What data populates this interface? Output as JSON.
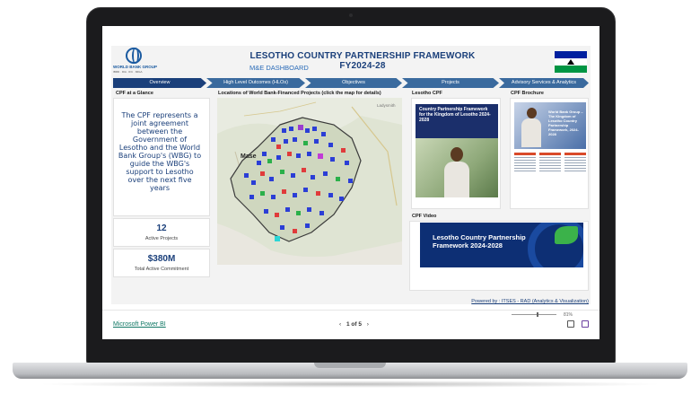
{
  "header": {
    "org_logo_text": "WORLD BANK GROUP",
    "org_logo_sub": "IBRD · IDA · IFC · MIGA",
    "title": "LESOTHO COUNTRY PARTNERSHIP FRAMEWORK FY2024-28",
    "subtitle": "M&E DASHBOARD"
  },
  "nav": [
    {
      "label": "Overview"
    },
    {
      "label": "High Level Outcomes (HLOs)"
    },
    {
      "label": "Objectives"
    },
    {
      "label": "Projects"
    },
    {
      "label": "Advisory Services & Analytics"
    }
  ],
  "glance": {
    "header": "CPF at a Glance",
    "text": "The CPF represents a joint agreement between the Government of Lesotho and the World Bank Group's (WBG) to guide the WBG's support to Lesotho over the next five years",
    "kpis": [
      {
        "value": "12",
        "label": "Active Projects"
      },
      {
        "value": "$380M",
        "label": "Total Active Commitment"
      }
    ]
  },
  "map": {
    "header": "Locations of World Bank-Financed Projects (click the map for details)",
    "label_capital": "Mase",
    "label_town": "Ladysmith"
  },
  "cpf": {
    "header": "Lesotho CPF",
    "cover_title": "Country Partnership Framework for the Kingdom of Lesotho 2024-2028"
  },
  "brochure": {
    "header": "CPF Brochure",
    "title": "World Bank Group – The Kingdom of Lesotho Country Partnership Framework, 2024-2028"
  },
  "video": {
    "header": "CPF Video",
    "title": "Lesotho Country Partnership Framework 2024-2028"
  },
  "powered_by": "Powered by : ITSES - RAD (Analytics & Visualization)",
  "footer": {
    "powerbi_link": "Microsoft Power BI",
    "page": "1 of 5",
    "prev": "‹",
    "next": "›",
    "zoom": "81%"
  }
}
